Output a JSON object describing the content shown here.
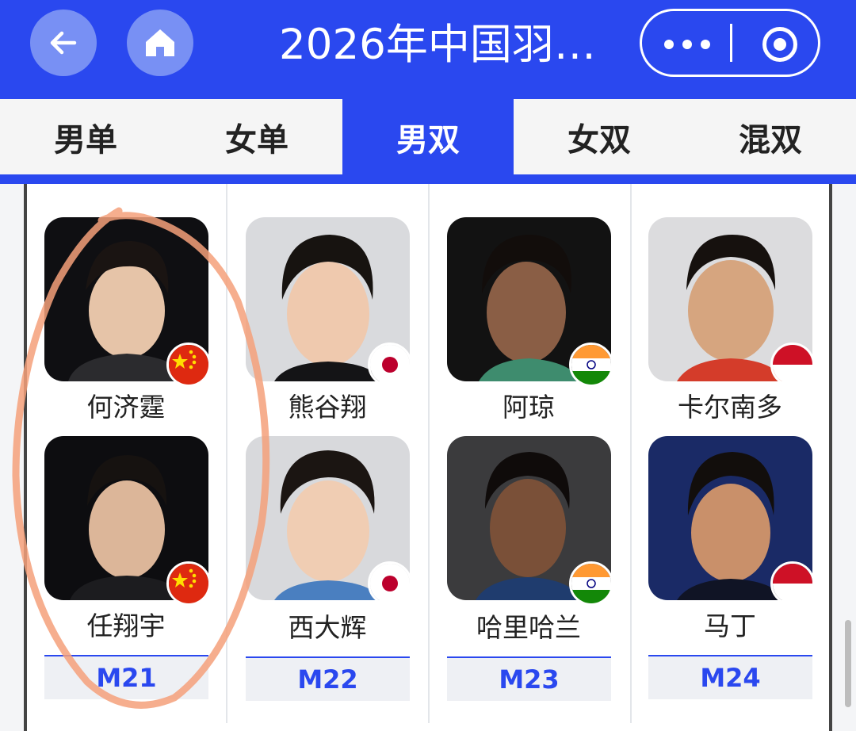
{
  "header": {
    "title": "2026年中国羽…",
    "back_icon": "back-arrow-icon",
    "home_icon": "home-icon",
    "more_icon": "more-dots-icon",
    "close_icon": "target-circle-icon",
    "accent": "#2a48ef"
  },
  "tabs": [
    {
      "label": "男单",
      "active": false
    },
    {
      "label": "女单",
      "active": false
    },
    {
      "label": "男双",
      "active": true
    },
    {
      "label": "女双",
      "active": false
    },
    {
      "label": "混双",
      "active": false
    }
  ],
  "players": {
    "row1": [
      {
        "name": "何济霆",
        "flag": "China"
      },
      {
        "name": "熊谷翔",
        "flag": "Japan"
      },
      {
        "name": "阿琼",
        "flag": "India"
      },
      {
        "name": "卡尔南多",
        "flag": "Indonesia"
      }
    ],
    "row2": [
      {
        "name": "任翔宇",
        "flag": "China"
      },
      {
        "name": "西大辉",
        "flag": "Japan"
      },
      {
        "name": "哈里哈兰",
        "flag": "India"
      },
      {
        "name": "马丁",
        "flag": "Indonesia"
      }
    ]
  },
  "matches": [
    "M21",
    "M22",
    "M23",
    "M24"
  ]
}
